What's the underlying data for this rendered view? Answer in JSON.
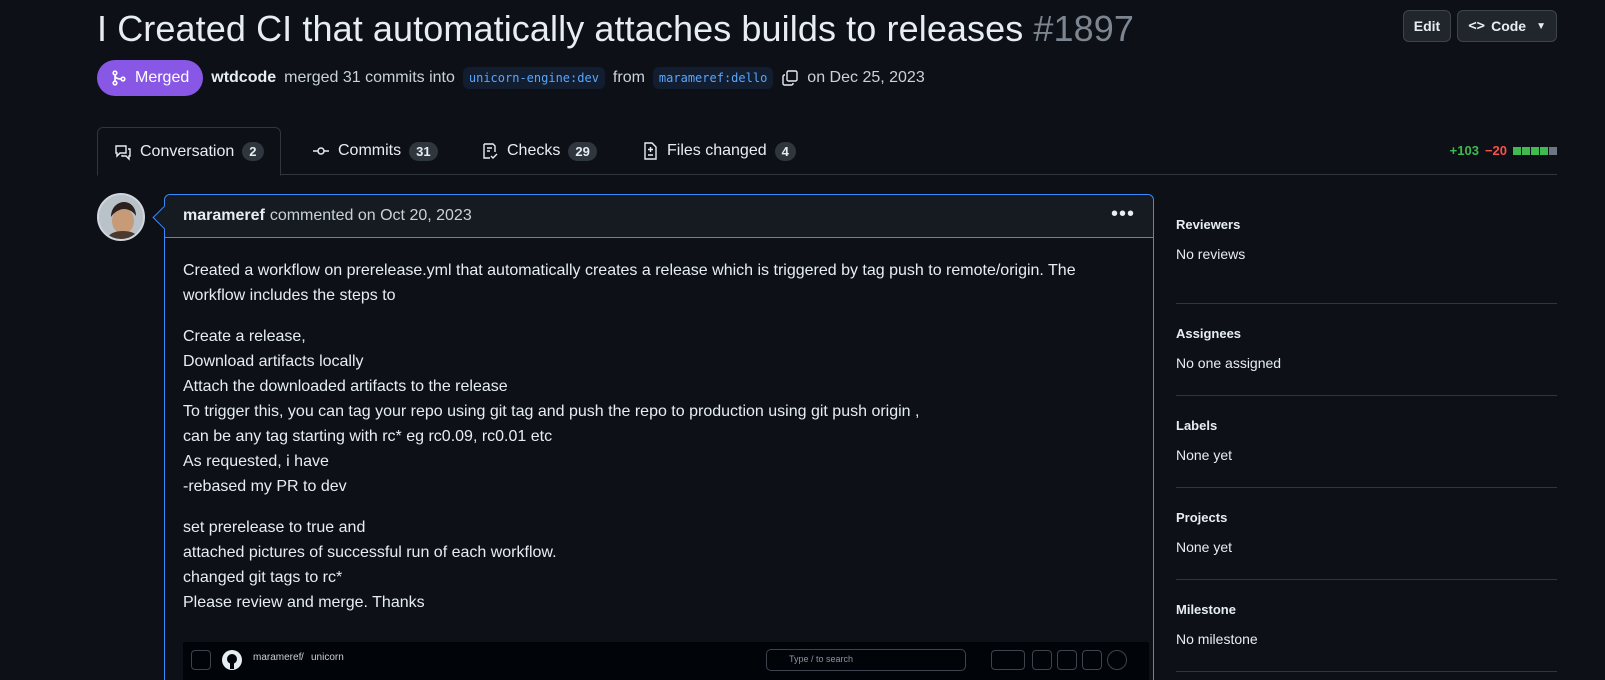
{
  "pr": {
    "title": "I Created CI that automatically attaches builds to releases",
    "number": "#1897",
    "state": "Merged",
    "author": "wtdcode",
    "merge_text": "merged 31 commits into",
    "base_branch": "unicorn-engine:dev",
    "from_text": "from",
    "head_branch": "marameref:dello",
    "date_text": "on Dec 25, 2023"
  },
  "actions": {
    "edit_label": "Edit",
    "code_label": "Code"
  },
  "tabs": [
    {
      "label": "Conversation",
      "count": "2"
    },
    {
      "label": "Commits",
      "count": "31"
    },
    {
      "label": "Checks",
      "count": "29"
    },
    {
      "label": "Files changed",
      "count": "4"
    }
  ],
  "diffstat": {
    "additions": "+103",
    "deletions": "−20",
    "blocks": [
      "#3fb950",
      "#3fb950",
      "#3fb950",
      "#3fb950",
      "#6e7681"
    ]
  },
  "comment": {
    "author": "marameref",
    "action": "commented on Oct 20, 2023",
    "para1": [
      "Created a workflow on prerelease.yml that automatically creates a release which is triggered by tag push to remote/origin. The",
      "workflow includes the steps to"
    ],
    "para2": [
      "Create a release,",
      "Download artifacts locally",
      "Attach the downloaded artifacts to the release",
      "To trigger this, you can tag your repo using git tag and push the repo to production using git push origin ,",
      "can be any tag starting with rc* eg rc0.09, rc0.01 etc",
      "As requested, i have",
      "-rebased my PR to dev"
    ],
    "para3": [
      "set prerelease to true and",
      "attached pictures of successful run of each workflow.",
      "changed git tags to rc*",
      "Please review and merge. Thanks"
    ],
    "screenshot": {
      "breadcrumb_owner": "marameref",
      "breadcrumb_sep": "/",
      "breadcrumb_repo": "unicorn",
      "search_placeholder": "Type / to search"
    }
  },
  "sidebar": [
    {
      "heading": "Reviewers",
      "value": "No reviews"
    },
    {
      "heading": "Assignees",
      "value": "No one assigned"
    },
    {
      "heading": "Labels",
      "value": "None yet"
    },
    {
      "heading": "Projects",
      "value": "None yet"
    },
    {
      "heading": "Milestone",
      "value": "No milestone"
    }
  ]
}
